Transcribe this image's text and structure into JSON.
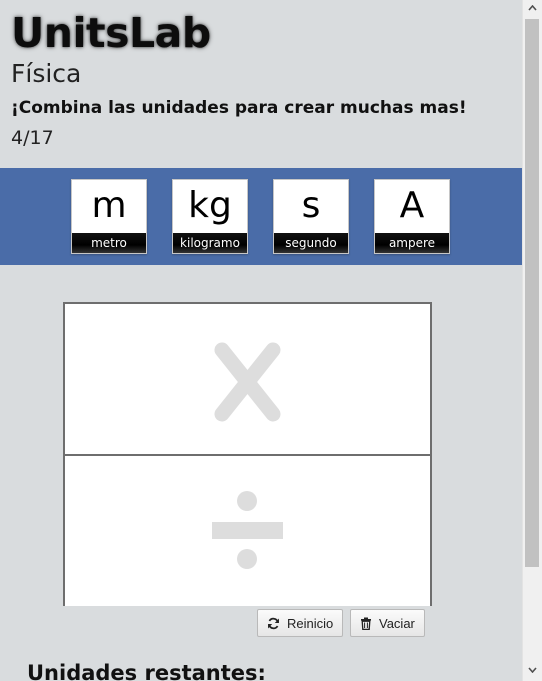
{
  "header": {
    "title": "UnitsLab",
    "subtitle": "Física",
    "tagline": "¡Combina las unidades para crear muchas mas!",
    "progress": "4/17"
  },
  "units": [
    {
      "symbol": "m",
      "name": "metro"
    },
    {
      "symbol": "kg",
      "name": "kilogramo"
    },
    {
      "symbol": "s",
      "name": "segundo"
    },
    {
      "symbol": "A",
      "name": "ampere"
    }
  ],
  "workspace": {
    "multiply_icon": "multiply-icon",
    "divide_icon": "divide-icon"
  },
  "buttons": {
    "reset_label": "Reinicio",
    "reset_icon": "refresh-icon",
    "clear_label": "Vaciar",
    "clear_icon": "trash-icon"
  },
  "remaining": {
    "title": "Unidades restantes:"
  },
  "colors": {
    "unit_bar": "#4a6ca8",
    "background": "#d9dcde",
    "operator_glyph": "#dddddd"
  }
}
